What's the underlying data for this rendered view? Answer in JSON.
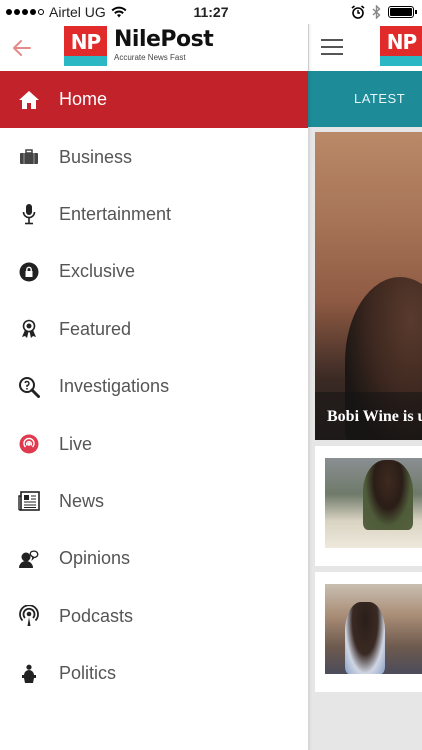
{
  "status_bar": {
    "carrier": "Airtel UG",
    "time": "11:27",
    "battery_level": 1.0
  },
  "drawer": {
    "logo": {
      "badge": "NP",
      "name": "NilePost",
      "tagline": "Accurate News Fast"
    },
    "items": [
      {
        "label": "Home",
        "icon": "home-icon",
        "active": true
      },
      {
        "label": "Business",
        "icon": "briefcase-icon",
        "active": false
      },
      {
        "label": "Entertainment",
        "icon": "microphone-icon",
        "active": false
      },
      {
        "label": "Exclusive",
        "icon": "lock-icon",
        "active": false
      },
      {
        "label": "Featured",
        "icon": "award-icon",
        "active": false
      },
      {
        "label": "Investigations",
        "icon": "magnifier-icon",
        "active": false
      },
      {
        "label": "Live",
        "icon": "live-broadcast-icon",
        "active": false
      },
      {
        "label": "News",
        "icon": "newspaper-icon",
        "active": false
      },
      {
        "label": "Opinions",
        "icon": "speaker-person-icon",
        "active": false
      },
      {
        "label": "Podcasts",
        "icon": "podcast-icon",
        "active": false
      },
      {
        "label": "Politics",
        "icon": "politician-icon",
        "active": false
      }
    ]
  },
  "background_app": {
    "tab_label": "LATEST",
    "hero_caption": "Bobi Wine is u",
    "colors": {
      "accent_red": "#c2232b",
      "tab_teal": "#1e8b99",
      "logo_red": "#e12a2a",
      "logo_teal": "#2bb7c4"
    }
  }
}
